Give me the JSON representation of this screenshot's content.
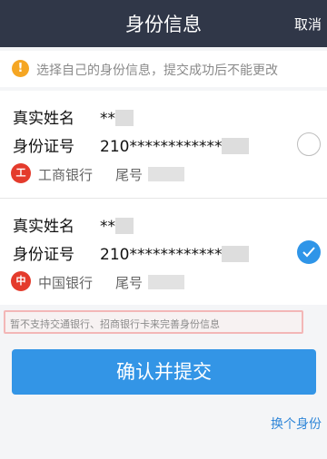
{
  "header": {
    "title": "身份信息",
    "cancel_label": "取消"
  },
  "notice": {
    "icon": "warning-icon",
    "text": "选择自己的身份信息，提交成功后不能更改"
  },
  "cards": [
    {
      "name_label": "真实姓名",
      "name_value": "**",
      "id_label": "身份证号",
      "id_value": "210************",
      "bank_logo": "工",
      "bank_name": "工商银行",
      "tail_label": "尾号",
      "selected": false
    },
    {
      "name_label": "真实姓名",
      "name_value": "**",
      "id_label": "身份证号",
      "id_value": "210************",
      "bank_logo": "中",
      "bank_name": "中国银行",
      "tail_label": "尾号",
      "selected": true
    }
  ],
  "unsupported_text": "暂不支持交通银行、招商银行卡来完善身份信息",
  "confirm_label": "确认并提交",
  "switch_label": "换个身份",
  "colors": {
    "header_bg": "#303748",
    "accent": "#3395e6",
    "warning": "#f5a623",
    "bank_red": "#e43b2c"
  }
}
